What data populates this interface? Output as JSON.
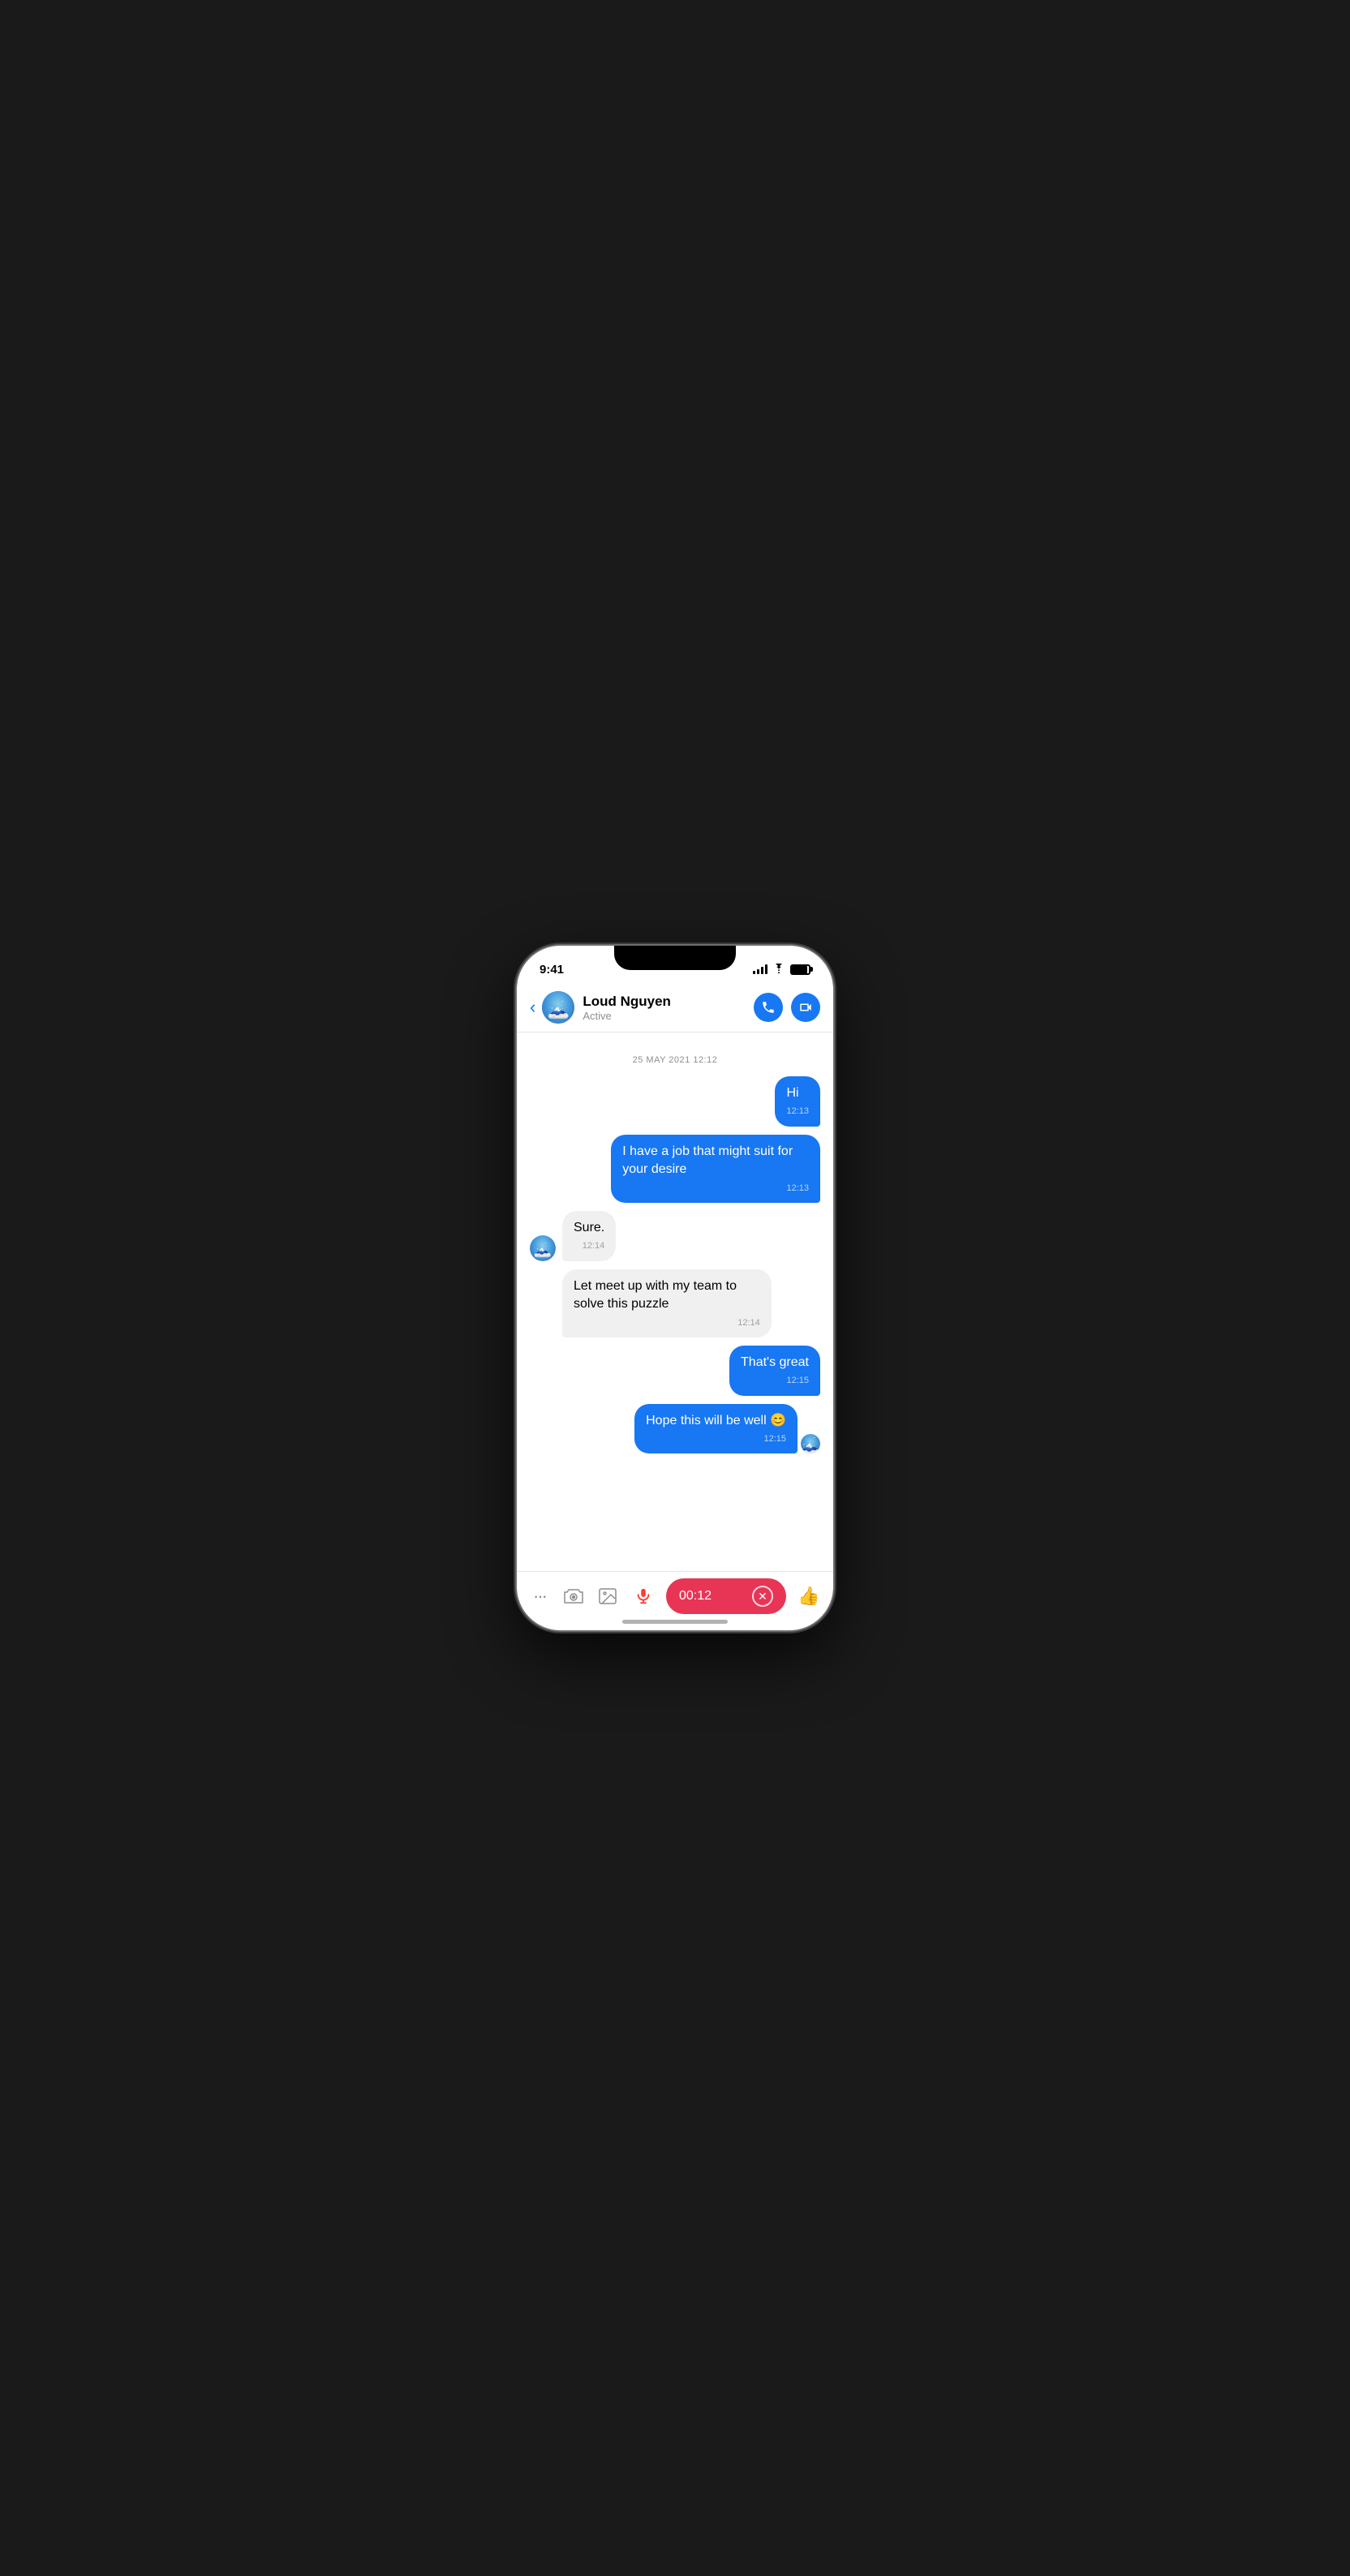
{
  "status_bar": {
    "time": "9:41"
  },
  "header": {
    "back_label": "‹",
    "contact_name": "Loud Nguyen",
    "contact_status": "Active",
    "phone_icon": "📞",
    "video_icon": "📹"
  },
  "messages": {
    "date_separator": "25 MAY 2021 12:12",
    "items": [
      {
        "id": "msg1",
        "type": "sent",
        "text": "Hi",
        "time": "12:13"
      },
      {
        "id": "msg2",
        "type": "sent",
        "text": "I have a job that might suit for your desire",
        "time": "12:13"
      },
      {
        "id": "msg3",
        "type": "received",
        "text": "Sure.",
        "time": "12:14"
      },
      {
        "id": "msg4",
        "type": "received",
        "text": "Let meet up with my team to solve this puzzle",
        "time": "12:14"
      },
      {
        "id": "msg5",
        "type": "sent",
        "text": "That's great",
        "time": "12:15"
      },
      {
        "id": "msg6",
        "type": "sent",
        "text": "Hope this will be well 😊",
        "time": "12:15",
        "show_avatar": true
      }
    ]
  },
  "input_bar": {
    "recording_time": "00:12",
    "dots_label": "···",
    "cancel_label": "✕",
    "thumbs_label": "👍"
  }
}
